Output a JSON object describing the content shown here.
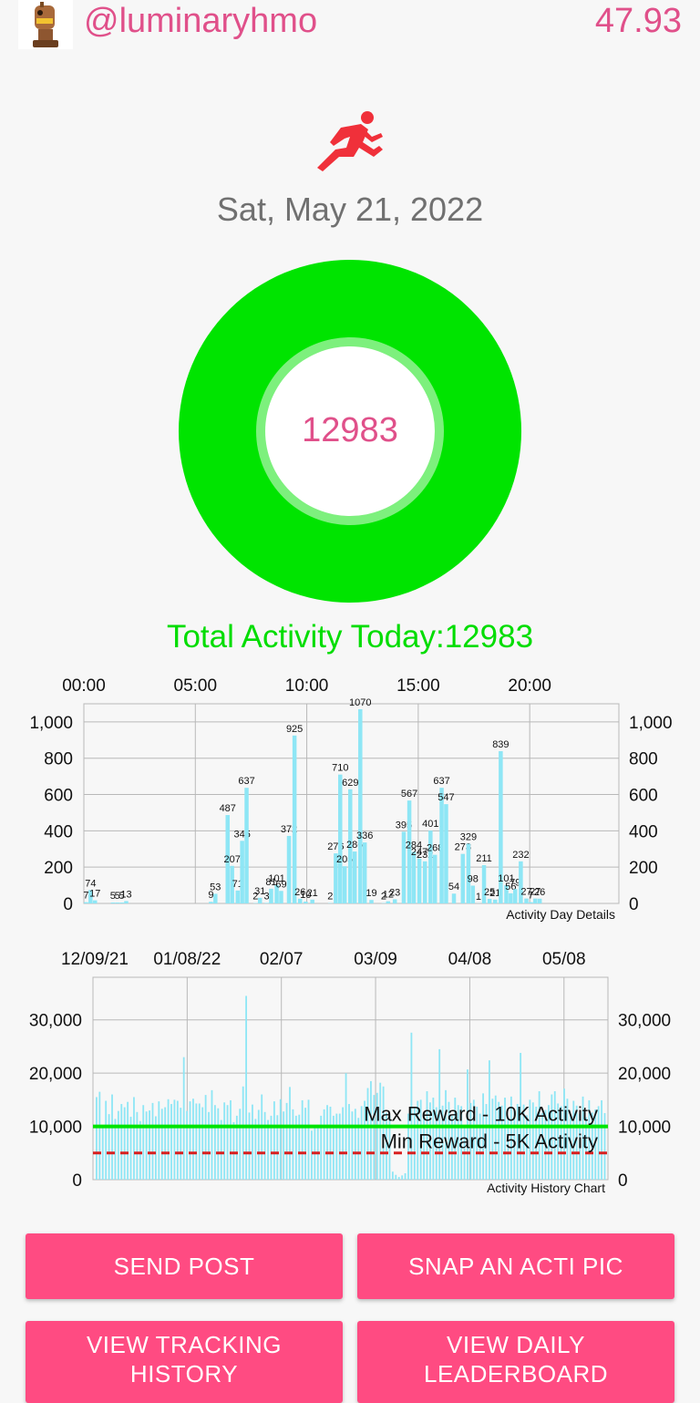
{
  "header": {
    "username": "@luminaryhmo",
    "balance": "47.93"
  },
  "date": "Sat, May 21, 2022",
  "ring": {
    "value": "12983",
    "color": "#00e400"
  },
  "total_label": "Total Activity Today:12983",
  "colors": {
    "accent": "#e0508a",
    "ring": "#00e400",
    "total_text": "#00dd00",
    "bar": "#8ee6f5",
    "button": "#ff4b82",
    "min_line": "#d82020",
    "max_line": "#00e400"
  },
  "icons": {
    "runner": "runner-icon",
    "avatar": "robot-avatar"
  },
  "chart_data": [
    {
      "type": "bar",
      "legend_text": "Activity Day Details",
      "x_ticks": [
        "00:00",
        "05:00",
        "10:00",
        "15:00",
        "20:00"
      ],
      "y_ticks": [
        "0",
        "200",
        "400",
        "600",
        "800",
        "1,000"
      ],
      "ylim": [
        0,
        1100
      ],
      "xlim": [
        0,
        24
      ],
      "bars": [
        {
          "x": 0.1,
          "v": 7,
          "label": "7"
        },
        {
          "x": 0.3,
          "v": 74,
          "label": "74"
        },
        {
          "x": 0.5,
          "v": 17,
          "label": "17"
        },
        {
          "x": 1.3,
          "v": 5,
          "label": "5"
        },
        {
          "x": 1.5,
          "v": 5,
          "label": "5"
        },
        {
          "x": 1.7,
          "v": 5,
          "label": "5"
        },
        {
          "x": 1.9,
          "v": 13,
          "label": "13"
        },
        {
          "x": 5.7,
          "v": 9,
          "label": "9"
        },
        {
          "x": 5.9,
          "v": 53,
          "label": "53"
        },
        {
          "x": 6.45,
          "v": 487,
          "label": "487"
        },
        {
          "x": 6.65,
          "v": 207,
          "label": "207"
        },
        {
          "x": 6.9,
          "v": 71,
          "label": "71"
        },
        {
          "x": 7.1,
          "v": 345,
          "label": "345"
        },
        {
          "x": 7.3,
          "v": 637,
          "label": "637"
        },
        {
          "x": 7.7,
          "v": 2,
          "label": "2"
        },
        {
          "x": 7.9,
          "v": 31,
          "label": "31"
        },
        {
          "x": 8.2,
          "v": 3,
          "label": "3"
        },
        {
          "x": 8.4,
          "v": 81,
          "label": "81"
        },
        {
          "x": 8.65,
          "v": 101,
          "label": "101"
        },
        {
          "x": 8.85,
          "v": 69,
          "label": "69"
        },
        {
          "x": 9.2,
          "v": 372,
          "label": "372"
        },
        {
          "x": 9.45,
          "v": 925,
          "label": "925"
        },
        {
          "x": 9.7,
          "v": 26,
          "label": "26"
        },
        {
          "x": 9.95,
          "v": 10,
          "label": "10"
        },
        {
          "x": 10.25,
          "v": 21,
          "label": "21"
        },
        {
          "x": 11.05,
          "v": 2,
          "label": "2"
        },
        {
          "x": 11.3,
          "v": 276,
          "label": "276"
        },
        {
          "x": 11.5,
          "v": 710,
          "label": "710"
        },
        {
          "x": 11.7,
          "v": 205,
          "label": "205"
        },
        {
          "x": 11.95,
          "v": 629,
          "label": "629"
        },
        {
          "x": 12.15,
          "v": 286,
          "label": "286"
        },
        {
          "x": 12.4,
          "v": 1070,
          "label": "1070"
        },
        {
          "x": 12.6,
          "v": 336,
          "label": "336"
        },
        {
          "x": 12.9,
          "v": 19,
          "label": "19"
        },
        {
          "x": 13.45,
          "v": 2,
          "label": "2"
        },
        {
          "x": 13.65,
          "v": 12,
          "label": "12"
        },
        {
          "x": 13.95,
          "v": 23,
          "label": "23"
        },
        {
          "x": 14.35,
          "v": 395,
          "label": "395"
        },
        {
          "x": 14.6,
          "v": 567,
          "label": "567"
        },
        {
          "x": 14.8,
          "v": 284,
          "label": "284"
        },
        {
          "x": 15.05,
          "v": 247,
          "label": "247"
        },
        {
          "x": 15.3,
          "v": 232,
          "label": "232"
        },
        {
          "x": 15.55,
          "v": 401,
          "label": "401"
        },
        {
          "x": 15.75,
          "v": 268,
          "label": "268"
        },
        {
          "x": 16.05,
          "v": 637,
          "label": "637"
        },
        {
          "x": 16.25,
          "v": 547,
          "label": "547"
        },
        {
          "x": 16.6,
          "v": 54,
          "label": "54"
        },
        {
          "x": 17.0,
          "v": 273,
          "label": "273"
        },
        {
          "x": 17.25,
          "v": 329,
          "label": "329"
        },
        {
          "x": 17.45,
          "v": 98,
          "label": "98"
        },
        {
          "x": 17.7,
          "v": 1,
          "label": "1"
        },
        {
          "x": 17.95,
          "v": 211,
          "label": "211"
        },
        {
          "x": 18.2,
          "v": 25,
          "label": "25"
        },
        {
          "x": 18.45,
          "v": 21,
          "label": "21"
        },
        {
          "x": 18.7,
          "v": 839,
          "label": "839"
        },
        {
          "x": 18.95,
          "v": 101,
          "label": "101"
        },
        {
          "x": 19.15,
          "v": 56,
          "label": "56"
        },
        {
          "x": 19.35,
          "v": 79,
          "label": "79"
        },
        {
          "x": 19.6,
          "v": 232,
          "label": "232"
        },
        {
          "x": 19.85,
          "v": 27,
          "label": "27"
        },
        {
          "x": 20.05,
          "v": 7,
          "label": "7"
        },
        {
          "x": 20.25,
          "v": 27,
          "label": "27"
        },
        {
          "x": 20.45,
          "v": 26,
          "label": "26"
        }
      ]
    },
    {
      "type": "bar",
      "legend_text": "Activity History Chart",
      "x_ticks": [
        "12/09/21",
        "01/08/22",
        "02/07",
        "03/09",
        "04/08",
        "05/08"
      ],
      "y_ticks": [
        "0",
        "10,000",
        "20,000",
        "30,000"
      ],
      "ylim": [
        0,
        38000
      ],
      "xlim": [
        0,
        164
      ],
      "reference_lines": [
        {
          "label": "Max Reward - 10K Activity",
          "value": 10000,
          "style": "solid",
          "color": "#00e400"
        },
        {
          "label": "Min Reward - 5K Activity",
          "value": 5000,
          "style": "dashed",
          "color": "#d82020"
        }
      ],
      "values": [
        15500,
        16500,
        10200,
        14800,
        12300,
        16000,
        11400,
        12900,
        14200,
        13600,
        14600,
        11800,
        15500,
        12700,
        11000,
        14000,
        12800,
        13000,
        14400,
        11900,
        14700,
        13300,
        13600,
        15100,
        14200,
        15000,
        14800,
        13500,
        23000,
        12900,
        14700,
        15200,
        14300,
        14300,
        13600,
        15900,
        12700,
        16800,
        14000,
        13400,
        11200,
        14500,
        14000,
        14900,
        10800,
        12000,
        13300,
        17500,
        34500,
        12600,
        14100,
        11400,
        13100,
        16000,
        12700,
        11200,
        12000,
        14700,
        12100,
        15100,
        12800,
        14400,
        17400,
        13200,
        12000,
        12200,
        14900,
        13500,
        15000,
        9200,
        9800,
        10300,
        12000,
        13200,
        14000,
        13700,
        12000,
        12400,
        12400,
        13600,
        20000,
        14200,
        12800,
        13300,
        11600,
        13800,
        14800,
        17200,
        18500,
        15900,
        16300,
        18200,
        17500,
        12600,
        12000,
        1500,
        900,
        500,
        800,
        1200,
        12400,
        27600,
        13600,
        14800,
        15000,
        12700,
        16600,
        14500,
        15400,
        13600,
        24500,
        13900,
        16800,
        14600,
        12000,
        15400,
        14000,
        13800,
        10300,
        20700,
        14400,
        15000,
        13700,
        12400,
        16200,
        14200,
        22400,
        15200,
        15800,
        14600,
        13900,
        15400,
        11700,
        15600,
        13000,
        14200,
        23800,
        14100,
        12100,
        15000,
        14500,
        13700,
        16600,
        12500,
        13100,
        14000,
        16000,
        16600,
        14300,
        13800,
        17100,
        15200,
        12000,
        14800,
        13900,
        12300,
        15600,
        11700,
        14900,
        12600,
        13200,
        13800,
        14900,
        12500
      ]
    }
  ],
  "buttons": {
    "send_post": "SEND POST",
    "snap_pic": "SNAP AN ACTI PIC",
    "view_tracking_line1": "VIEW TRACKING",
    "view_tracking_line2": "HISTORY",
    "view_leaderboard_line1": "VIEW DAILY",
    "view_leaderboard_line2": "LEADERBOARD"
  }
}
